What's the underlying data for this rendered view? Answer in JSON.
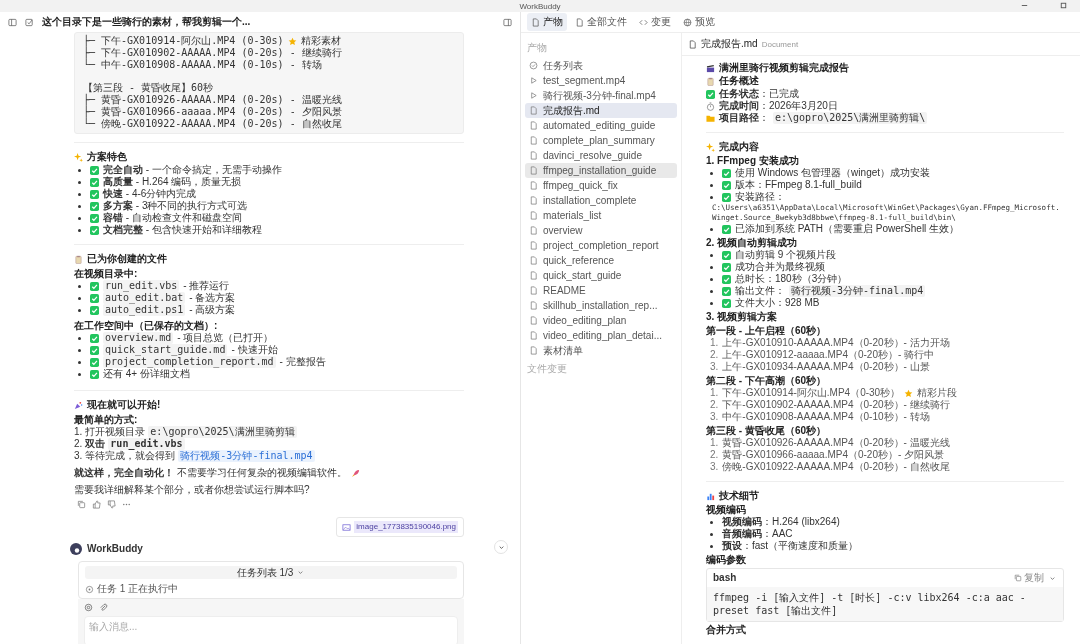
{
  "window": {
    "title": "WorkBuddy"
  },
  "chat": {
    "title": "这个目录下是一些骑行的素材，帮我剪辑一个...",
    "code_block": {
      "groups": [
        [
          {
            "kind": "starred",
            "text": "├─ 下午-GX010914-阿尔山.MP4 (0-30s)",
            "note": "精彩素材"
          },
          {
            "kind": "plain",
            "text": "├─ 下午-GX010902-AAAAA.MP4 (0-20s) - 继续骑行"
          },
          {
            "kind": "plain",
            "text": "└─ 中午-GX010908-AAAAA.MP4 (0-10s) - 转场"
          }
        ],
        [
          {
            "kind": "plain",
            "text": "【第三段 - 黄昏收尾】60秒"
          },
          {
            "kind": "plain",
            "text": "├─ 黄昏-GX010926-AAAAA.MP4 (0-20s) - 温暖光线"
          },
          {
            "kind": "plain",
            "text": "├─ 黄昏-GX010966-aaaaa.MP4 (0-20s) - 夕阳风景"
          },
          {
            "kind": "plain",
            "text": "└─ 傍晚-GX010922-AAAAA.MP4 (0-20s) - 自然收尾"
          }
        ]
      ]
    },
    "features": {
      "heading": "方案特色",
      "items": [
        "**完全自动** - 一个命令搞定，无需手动操作",
        "**高质量** - H.264 编码，质量无损",
        "**快速** - 4-6分钟内完成",
        "**多方案** - 3种不同的执行方式可选",
        "**容错** - 自动检查文件和磁盘空间",
        "**文档完整** - 包含快速开始和详细教程"
      ]
    },
    "files": {
      "heading": "已为你创建的文件",
      "groups": [
        {
          "label": "在视频目录中:",
          "items": [
            {
              "code": "run_edit.vbs",
              "text": "- 推荐运行"
            },
            {
              "code": "auto_edit.bat",
              "text": "- 备选方案"
            },
            {
              "code": "auto_edit.ps1",
              "text": "- 高级方案"
            }
          ]
        },
        {
          "label": "在工作空间中（已保存的文档）:",
          "items": [
            {
              "code": "overview.md",
              "text": "- 项目总览（已打开）"
            },
            {
              "code": "quick_start_guide.md",
              "text": "- 快速开始"
            },
            {
              "code": "project_completion_report.md",
              "text": "- 完整报告"
            },
            {
              "text": "还有 4+ 份详细文档"
            }
          ]
        }
      ]
    },
    "start": {
      "heading": "现在就可以开始!",
      "label": "最简单的方式:",
      "steps": [
        {
          "number": "1.",
          "kind": "plain",
          "text": "打开视频目录",
          "code": "e:\\gopro\\2025\\满洲里骑剪辑"
        },
        {
          "number": "2.",
          "kind": "bold",
          "text": "双击",
          "code": "run_edit.vbs"
        },
        {
          "number": "3.",
          "kind": "link",
          "text": "等待完成，就会得到",
          "code": "骑行视频-3分钟-final.mp4"
        }
      ]
    },
    "closing": "**就这样，完全自动化！** 不需要学习任何复杂的视频编辑软件。",
    "question": "需要我详细解释某个部分，或者你想尝试运行脚本吗?",
    "attachment": "image_1773835190046.png",
    "assistant_name": "WorkBuddy",
    "task_panel": {
      "title": "任务列表 1/3",
      "status": "任务 1 正在执行中"
    },
    "input": {
      "placeholder": "输入消息..."
    }
  },
  "files_panel": {
    "tabs": [
      {
        "label": "产物",
        "selected": true
      },
      {
        "label": "全部文件",
        "selected": false
      },
      {
        "label": "变更",
        "selected": false
      },
      {
        "label": "预览",
        "selected": false
      }
    ],
    "section": "产物",
    "items": [
      {
        "kind": "task",
        "name": "任务列表",
        "selected": false,
        "hovered": false
      },
      {
        "kind": "video",
        "name": "test_segment.mp4",
        "selected": false,
        "hovered": false
      },
      {
        "kind": "video",
        "name": "骑行视频-3分钟-final.mp4",
        "selected": false,
        "hovered": false
      },
      {
        "kind": "doc",
        "name": "完成报告.md",
        "selected": true,
        "hovered": false
      },
      {
        "kind": "doc",
        "name": "automated_editing_guide",
        "selected": false,
        "hovered": false
      },
      {
        "kind": "doc",
        "name": "complete_plan_summary",
        "selected": false,
        "hovered": false
      },
      {
        "kind": "doc",
        "name": "davinci_resolve_guide",
        "selected": false,
        "hovered": false
      },
      {
        "kind": "doc",
        "name": "ffmpeg_installation_guide",
        "selected": false,
        "hovered": true
      },
      {
        "kind": "doc",
        "name": "ffmpeg_quick_fix",
        "selected": false,
        "hovered": false
      },
      {
        "kind": "doc",
        "name": "installation_complete",
        "selected": false,
        "hovered": false
      },
      {
        "kind": "doc",
        "name": "materials_list",
        "selected": false,
        "hovered": false
      },
      {
        "kind": "doc",
        "name": "overview",
        "selected": false,
        "hovered": false
      },
      {
        "kind": "doc",
        "name": "project_completion_report",
        "selected": false,
        "hovered": false
      },
      {
        "kind": "doc",
        "name": "quick_reference",
        "selected": false,
        "hovered": false
      },
      {
        "kind": "doc",
        "name": "quick_start_guide",
        "selected": false,
        "hovered": false
      },
      {
        "kind": "doc",
        "name": "README",
        "selected": false,
        "hovered": false
      },
      {
        "kind": "doc",
        "name": "skillhub_installation_rep...",
        "selected": false,
        "hovered": false
      },
      {
        "kind": "doc",
        "name": "video_editing_plan",
        "selected": false,
        "hovered": false
      },
      {
        "kind": "doc",
        "name": "video_editing_plan_detai...",
        "selected": false,
        "hovered": false
      },
      {
        "kind": "doc",
        "name": "素材清单",
        "selected": false,
        "hovered": false
      }
    ],
    "footer_section": "文件变更"
  },
  "document": {
    "name": "完成报告.md",
    "type": "Document",
    "title": "满洲里骑行视频剪辑完成报告",
    "overview_heading": "任务概述",
    "meta": [
      {
        "kind": "status",
        "text": "**任务状态**：已完成"
      },
      {
        "kind": "time",
        "text": "**完成时间**：2026年3月20日"
      },
      {
        "kind": "path",
        "text": "**项目路径**：",
        "code": "e:\\gopro\\2025\\满洲里骑剪辑\\"
      }
    ],
    "content_heading": "完成内容",
    "steps": [
      {
        "title": "1. FFmpeg 安装成功",
        "items": [
          {
            "text": "使用 Windows 包管理器（winget）成功安装"
          },
          {
            "text": "版本：FFmpeg 8.1-full_build"
          },
          {
            "text": "安装路径：",
            "block": "C:\\Users\\a6351\\AppData\\Local\\Microsoft\\WinGet\\Packages\\Gyan.FFmpeg_Microsoft.Winget.Source_8wekyb3d8bbwe\\ffmpeg-8.1-full_build\\bin\\"
          },
          {
            "text": "已添加到系统 PATH（需要重启 PowerShell 生效）"
          }
        ]
      },
      {
        "title": "2. 视频自动剪辑成功",
        "items": [
          {
            "text": "自动剪辑 9 个视频片段"
          },
          {
            "text": "成功合并为最终视频"
          },
          {
            "text": "总时长：180秒（3分钟）"
          },
          {
            "text": "输出文件：",
            "code": "骑行视频-3分钟-final.mp4"
          },
          {
            "text": "文件大小：928 MB"
          }
        ]
      }
    ],
    "plan_title": "3. 视频剪辑方案",
    "segments": [
      {
        "title": "第一段 - 上午启程（60秒）",
        "clips": [
          {
            "number": "1.",
            "kind": "plain",
            "text": "上午-GX010910-AAAAA.MP4（0-20秒）- 活力开场"
          },
          {
            "number": "2.",
            "kind": "plain",
            "text": "上午-GX010912-aaaaa.MP4（0-20秒）- 骑行中"
          },
          {
            "number": "3.",
            "kind": "plain",
            "text": "上午-GX010934-AAAAA.MP4（0-20秒）- 山景"
          }
        ]
      },
      {
        "title": "第二段 - 下午高潮（60秒）",
        "clips": [
          {
            "number": "1.",
            "kind": "starred",
            "text": "下午-GX010914-阿尔山.MP4（0-30秒）",
            "note": "精彩片段"
          },
          {
            "number": "2.",
            "kind": "plain",
            "text": "下午-GX010902-AAAAA.MP4（0-20秒）- 继续骑行"
          },
          {
            "number": "3.",
            "kind": "plain",
            "text": "中午-GX010908-AAAAA.MP4（0-10秒）- 转场"
          }
        ]
      },
      {
        "title": "第三段 - 黄昏收尾（60秒）",
        "clips": [
          {
            "number": "1.",
            "kind": "plain",
            "text": "黄昏-GX010926-AAAAA.MP4（0-20秒）- 温暖光线"
          },
          {
            "number": "2.",
            "kind": "plain",
            "text": "黄昏-GX010966-aaaaa.MP4（0-20秒）- 夕阳风景"
          },
          {
            "number": "3.",
            "kind": "plain",
            "text": "傍晚-GX010922-AAAAA.MP4（0-20秒）- 自然收尾"
          }
        ]
      }
    ],
    "tech_heading": "技术细节",
    "tech_sub": "视频编码",
    "tech_items": [
      "**视频编码**：H.264 (libx264)",
      "**音频编码**：AAC",
      "**预设**：fast（平衡速度和质量）"
    ],
    "params_heading": "编码参数",
    "code": {
      "language": "bash",
      "copy": "复制",
      "command": "ffmpeg -i [输入文件] -t [时长] -c:v libx264 -c:a aac -preset fast [输出文件]"
    },
    "merge_heading": "合并方式"
  }
}
